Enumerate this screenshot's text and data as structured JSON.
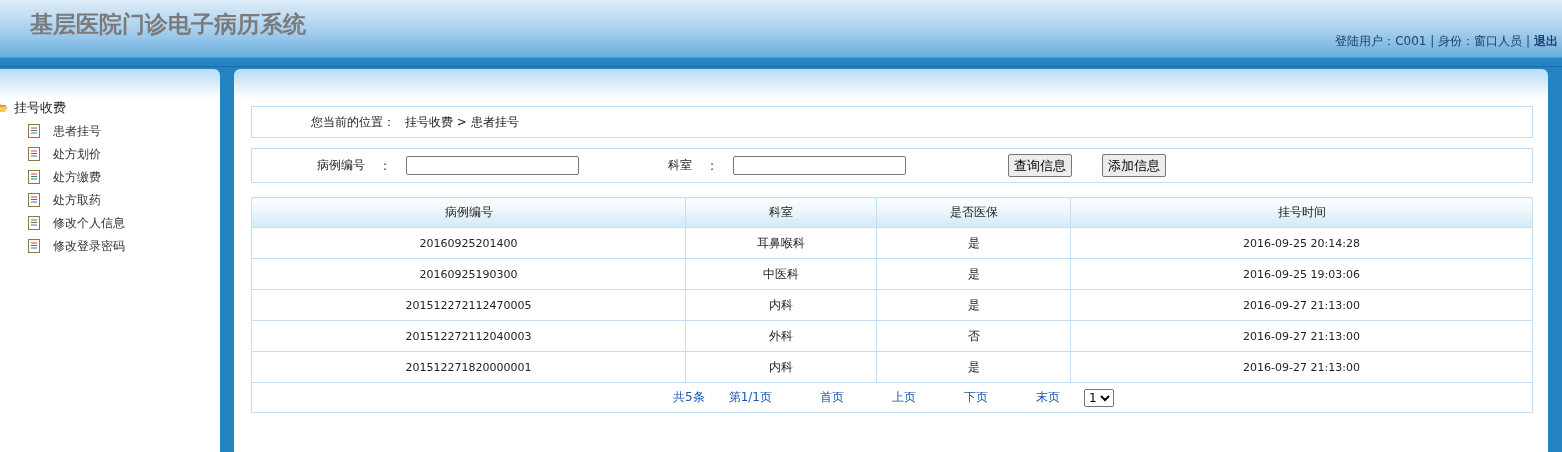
{
  "header": {
    "title": "基层医院门诊电子病历系统",
    "user_info": "登陆用户：C001 | 身份：窗口人员 |",
    "logout": "退出"
  },
  "sidebar": {
    "groups": [
      {
        "label": "挂号收费",
        "expanded": true,
        "children": [
          {
            "label": "患者挂号"
          },
          {
            "label": "处方划价"
          },
          {
            "label": "处方缴费"
          },
          {
            "label": "处方取药"
          },
          {
            "label": "修改个人信息"
          },
          {
            "label": "修改登录密码"
          }
        ]
      }
    ]
  },
  "breadcrumb": {
    "label": "您当前的位置：",
    "path": "挂号收费 > 患者挂号"
  },
  "search": {
    "fields": [
      {
        "label": "病例编号",
        "colon": ":"
      },
      {
        "label": "科室",
        "colon": ":"
      }
    ],
    "buttons": [
      "查询信息",
      "添加信息"
    ]
  },
  "table": {
    "columns": [
      "病例编号",
      "科室",
      "是否医保",
      "挂号时间"
    ],
    "rows": [
      [
        "20160925201400",
        "耳鼻喉科",
        "是",
        "2016-09-25 20:14:28"
      ],
      [
        "20160925190300",
        "中医科",
        "是",
        "2016-09-25 19:03:06"
      ],
      [
        "201512272112470005",
        "内科",
        "是",
        "2016-09-27 21:13:00"
      ],
      [
        "201512272112040003",
        "外科",
        "否",
        "2016-09-27 21:13:00"
      ],
      [
        "201512271820000001",
        "内科",
        "是",
        "2016-09-27 21:13:00"
      ]
    ]
  },
  "pagination": {
    "total": "共5条",
    "page": "第1/1页",
    "links": [
      "首页",
      "上页",
      "下页",
      "末页"
    ],
    "page_select": "1"
  }
}
